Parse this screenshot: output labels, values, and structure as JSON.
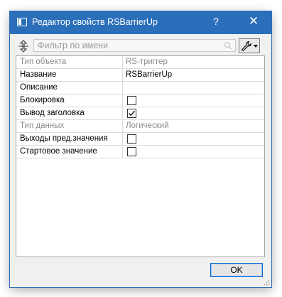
{
  "window": {
    "title": "Редактор свойств RSBarrierUp",
    "help": "?",
    "close": "✕"
  },
  "filter": {
    "placeholder": "Фильтр по имени",
    "value": ""
  },
  "properties": [
    {
      "name": "Тип объекта",
      "value": "RS-триггер",
      "type": "text",
      "disabled": true
    },
    {
      "name": "Название",
      "value": "RSBarrierUp",
      "type": "text",
      "disabled": false
    },
    {
      "name": "Описание",
      "value": "",
      "type": "text",
      "disabled": false
    },
    {
      "name": "Блокировка",
      "type": "checkbox",
      "checked": false,
      "disabled": false
    },
    {
      "name": "Вывод заголовка",
      "type": "checkbox",
      "checked": true,
      "disabled": false
    },
    {
      "name": "Тип данных",
      "value": "Логический",
      "type": "text",
      "disabled": true
    },
    {
      "name": "Выходы пред.значения",
      "type": "checkbox",
      "checked": false,
      "disabled": false
    },
    {
      "name": "Стартовое значение",
      "type": "checkbox",
      "checked": false,
      "disabled": false
    }
  ],
  "buttons": {
    "ok": "OK"
  },
  "colors": {
    "titlebar": "#2b6fba",
    "disabled_text": "#8c8c8c",
    "ok_border": "#0a64c8"
  },
  "icons": [
    "app-icon",
    "help-icon",
    "close-icon",
    "resize-icon",
    "search-icon",
    "wrench-icon",
    "dropdown-arrow-icon",
    "checkmark-icon",
    "resize-grip-icon"
  ]
}
